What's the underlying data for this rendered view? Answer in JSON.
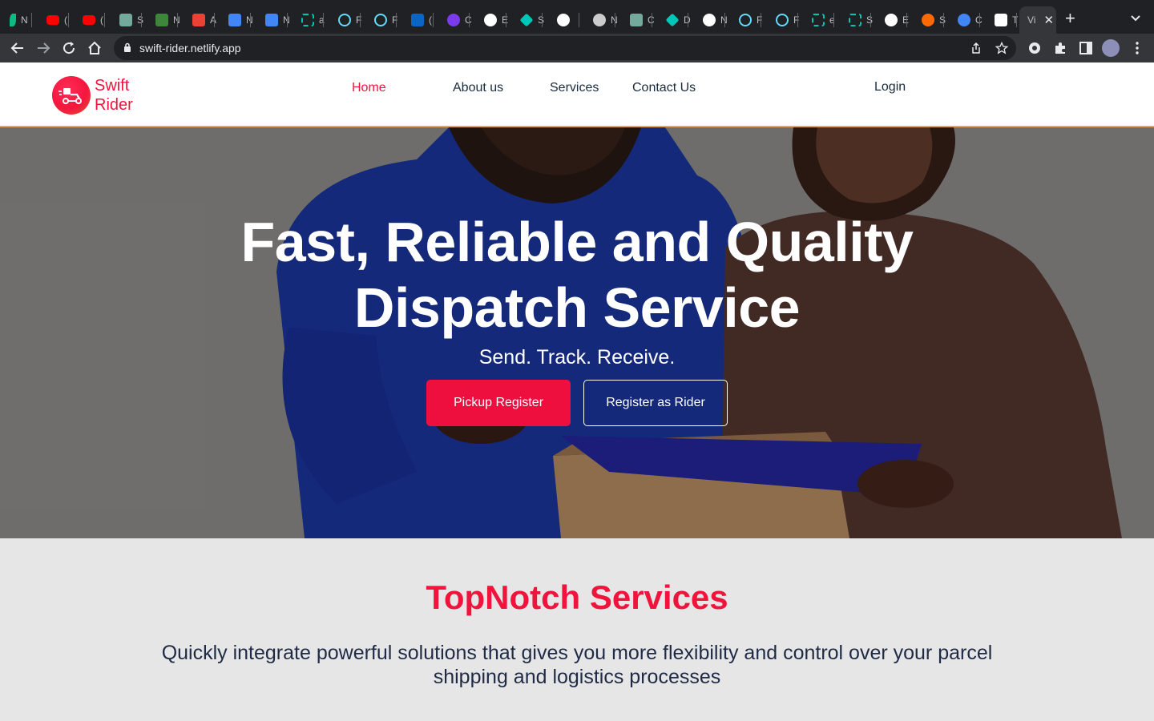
{
  "browser": {
    "tabs": [
      {
        "letter": "N",
        "color": "#10b981",
        "shape": "leaf"
      },
      {
        "letter": "(",
        "color": "#ff0000",
        "shape": "yt"
      },
      {
        "letter": "(",
        "color": "#ff0000",
        "shape": "yt"
      },
      {
        "letter": "S",
        "color": "#74aa9c",
        "shape": "square"
      },
      {
        "letter": "N",
        "color": "#3c873a",
        "shape": "hex"
      },
      {
        "letter": "A",
        "color": "#ea4335",
        "shape": "gmail"
      },
      {
        "letter": "N",
        "color": "#4285f4",
        "shape": "doc"
      },
      {
        "letter": "N",
        "color": "#4285f4",
        "shape": "doc"
      },
      {
        "letter": "a",
        "color": "#00c4b4",
        "shape": "frame"
      },
      {
        "letter": "F",
        "color": "#61dafb",
        "shape": "atom"
      },
      {
        "letter": "F",
        "color": "#61dafb",
        "shape": "atom"
      },
      {
        "letter": "(",
        "color": "#0a66c2",
        "shape": "in"
      },
      {
        "letter": "C",
        "color": "#7c3aed",
        "shape": "circle"
      },
      {
        "letter": "E",
        "color": "#ffffff",
        "shape": "circle"
      },
      {
        "letter": "S",
        "color": "#00c7b7",
        "shape": "diamond"
      },
      {
        "letter": "",
        "color": "#ffffff",
        "shape": "circle"
      },
      {
        "letter": "N",
        "color": "#cccccc",
        "shape": "circle"
      },
      {
        "letter": "C",
        "color": "#74aa9c",
        "shape": "square"
      },
      {
        "letter": "D",
        "color": "#00c7b7",
        "shape": "diamond"
      },
      {
        "letter": "N",
        "color": "#ffffff",
        "shape": "circle"
      },
      {
        "letter": "F",
        "color": "#61dafb",
        "shape": "atom"
      },
      {
        "letter": "F",
        "color": "#61dafb",
        "shape": "atom"
      },
      {
        "letter": "e",
        "color": "#00c4b4",
        "shape": "frame"
      },
      {
        "letter": "S",
        "color": "#00c4b4",
        "shape": "frame"
      },
      {
        "letter": "E",
        "color": "#ffffff",
        "shape": "circle"
      },
      {
        "letter": "S",
        "color": "#ff6a00",
        "shape": "circle"
      },
      {
        "letter": "C",
        "color": "#4285f4",
        "shape": "circle"
      },
      {
        "letter": "T",
        "color": "#ffffff",
        "shape": "square"
      }
    ],
    "active_tab_label": "Vi",
    "new_tab_label": "+",
    "url": "swift-rider.netlify.app"
  },
  "site": {
    "logo_line1": "Swift",
    "logo_line2": "Rider",
    "nav": [
      {
        "label": "Home",
        "active": true
      },
      {
        "label": "About us",
        "active": false
      },
      {
        "label": "Services",
        "active": false
      },
      {
        "label": "Contact Us",
        "active": false
      }
    ],
    "login_label": "Login",
    "brand_color": "#f0143c"
  },
  "hero": {
    "title_line1": "Fast, Reliable and Quality",
    "title_line2": "Dispatch Service",
    "subtitle": "Send. Track. Receive.",
    "primary_button": "Pickup Register",
    "secondary_button": "Register as Rider"
  },
  "services": {
    "title": "TopNotch Services",
    "description": "Quickly integrate powerful solutions that gives you more flexibility and control over your parcel shipping and logistics processes"
  }
}
